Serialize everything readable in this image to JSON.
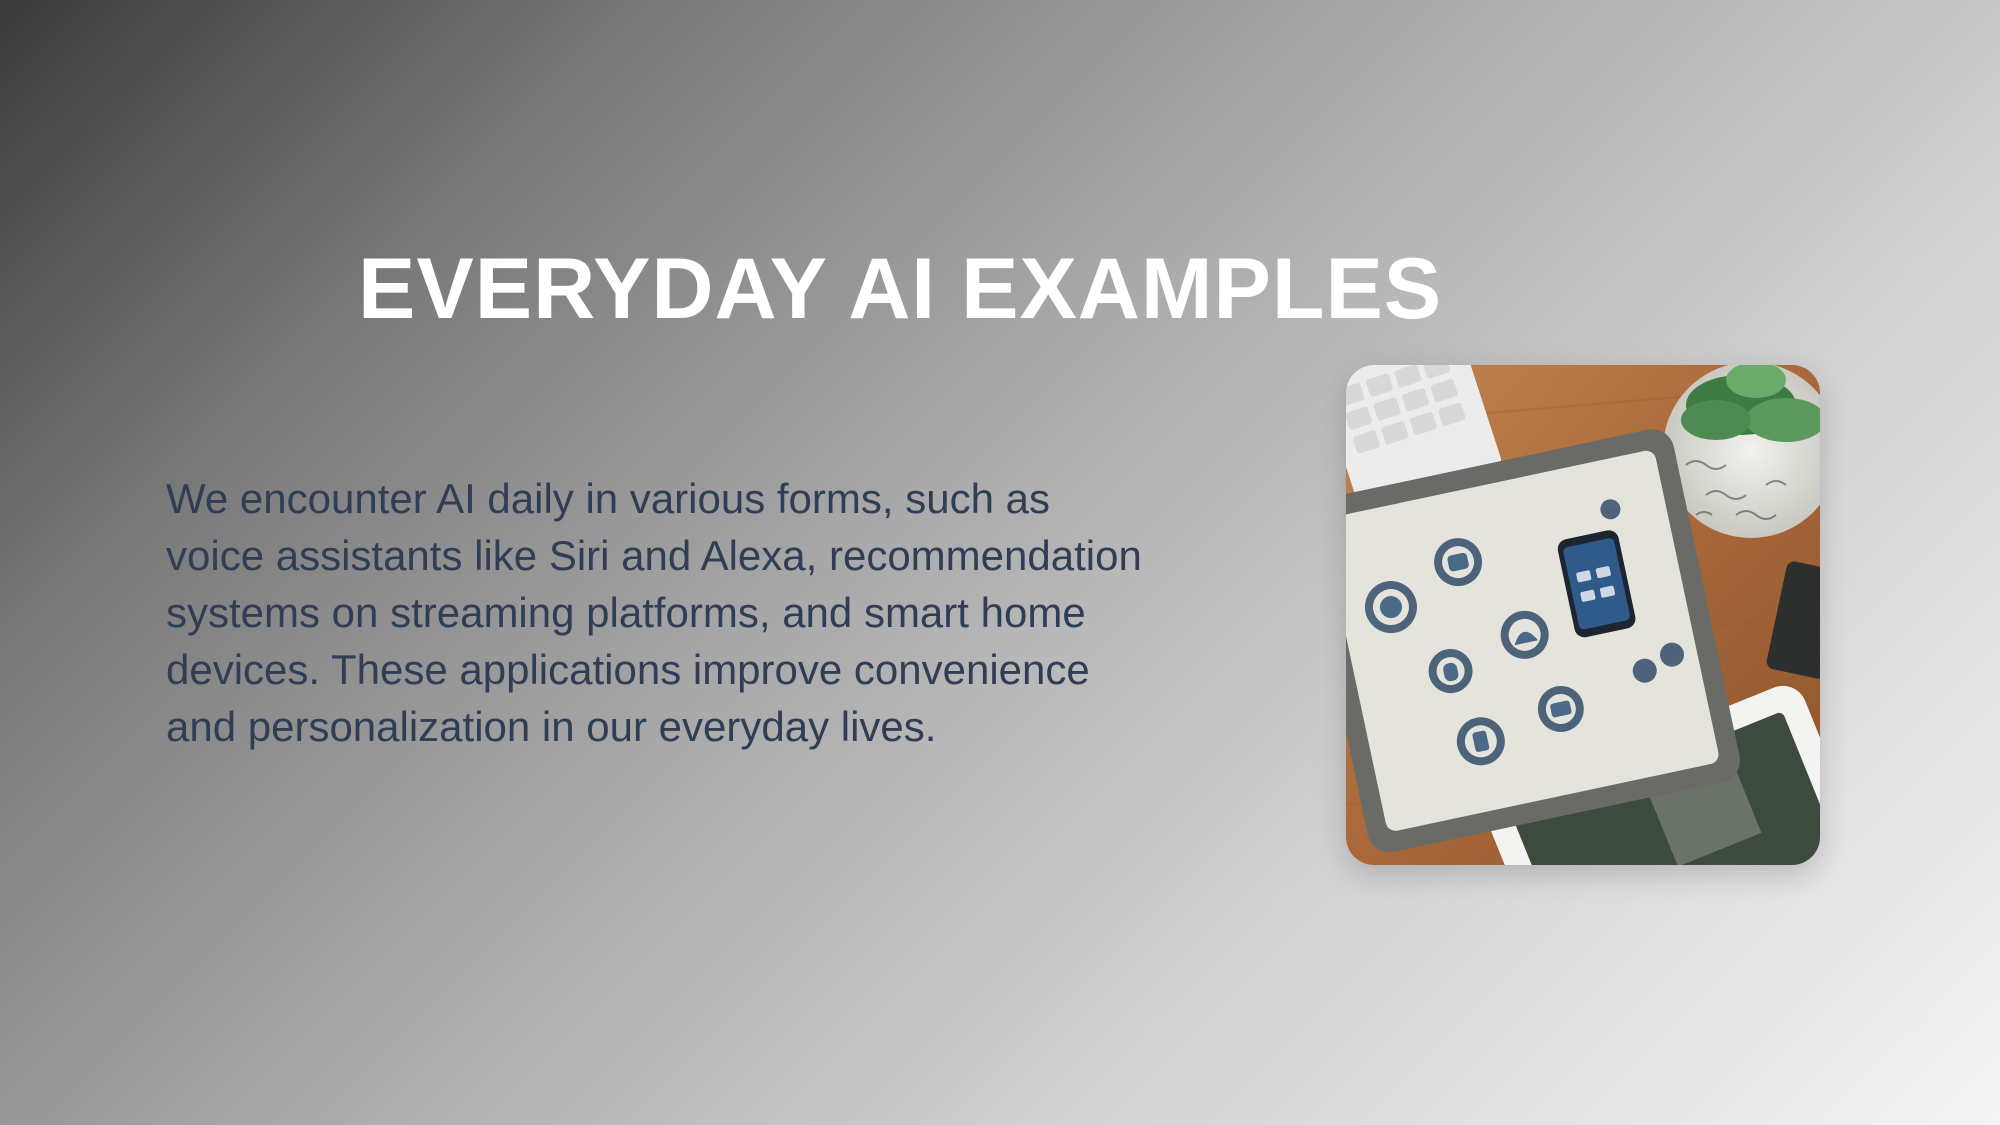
{
  "slide": {
    "title": "EVERYDAY AI EXAMPLES",
    "body_lines": [
      "We encounter AI daily in various forms, such as",
      "voice assistants like Siri and Alexa, recommendation",
      "systems on streaming platforms, and smart home",
      "devices. These applications improve convenience",
      "and personalization in our everyday lives."
    ]
  },
  "image": {
    "description_icon": "tablet-smart-home-photo"
  },
  "colors": {
    "title": "#ffffff",
    "body": "#2f3d55",
    "wood": "#b0713e"
  }
}
